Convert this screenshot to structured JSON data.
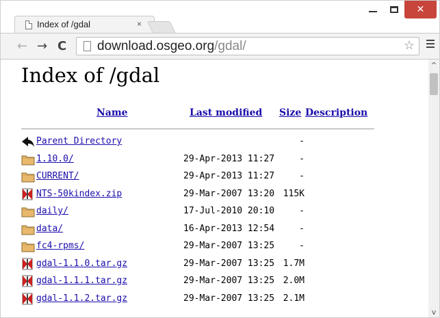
{
  "browser": {
    "tab_title": "Index of /gdal",
    "tab_close": "×",
    "url_host": "download.osgeo.org",
    "url_path": "/gdal/",
    "nav_back": "←",
    "nav_forward": "→",
    "nav_reload": "C",
    "star": "☆",
    "window_close": "✕",
    "scroll_up": "^",
    "scroll_down": "v"
  },
  "page": {
    "title": "Index of /gdal",
    "columns": {
      "name": "Name",
      "last_modified": "Last modified",
      "size": "Size",
      "description": "Description"
    },
    "rows": [
      {
        "icon": "back-icon",
        "name": "Parent Directory",
        "modified": "",
        "size": "-"
      },
      {
        "icon": "folder-icon",
        "name": "1.10.0/",
        "modified": "29-Apr-2013 11:27",
        "size": "-"
      },
      {
        "icon": "folder-icon",
        "name": "CURRENT/",
        "modified": "29-Apr-2013 11:27",
        "size": "-"
      },
      {
        "icon": "compressed-file-icon",
        "name": "NTS-50kindex.zip",
        "modified": "29-Mar-2007 13:20",
        "size": "115K"
      },
      {
        "icon": "folder-icon",
        "name": "daily/",
        "modified": "17-Jul-2010 20:10",
        "size": "-"
      },
      {
        "icon": "folder-icon",
        "name": "data/",
        "modified": "16-Apr-2013 12:54",
        "size": "-"
      },
      {
        "icon": "folder-icon",
        "name": "fc4-rpms/",
        "modified": "29-Mar-2007 13:25",
        "size": "-"
      },
      {
        "icon": "compressed-file-icon",
        "name": "gdal-1.1.0.tar.gz",
        "modified": "29-Mar-2007 13:25",
        "size": "1.7M"
      },
      {
        "icon": "compressed-file-icon",
        "name": "gdal-1.1.1.tar.gz",
        "modified": "29-Mar-2007 13:25",
        "size": "2.0M"
      },
      {
        "icon": "compressed-file-icon",
        "name": "gdal-1.1.2.tar.gz",
        "modified": "29-Mar-2007 13:25",
        "size": "2.1M"
      }
    ]
  },
  "colors": {
    "link": "#1a0dab",
    "close_button": "#c7453b",
    "folder": "#e8b86d"
  }
}
